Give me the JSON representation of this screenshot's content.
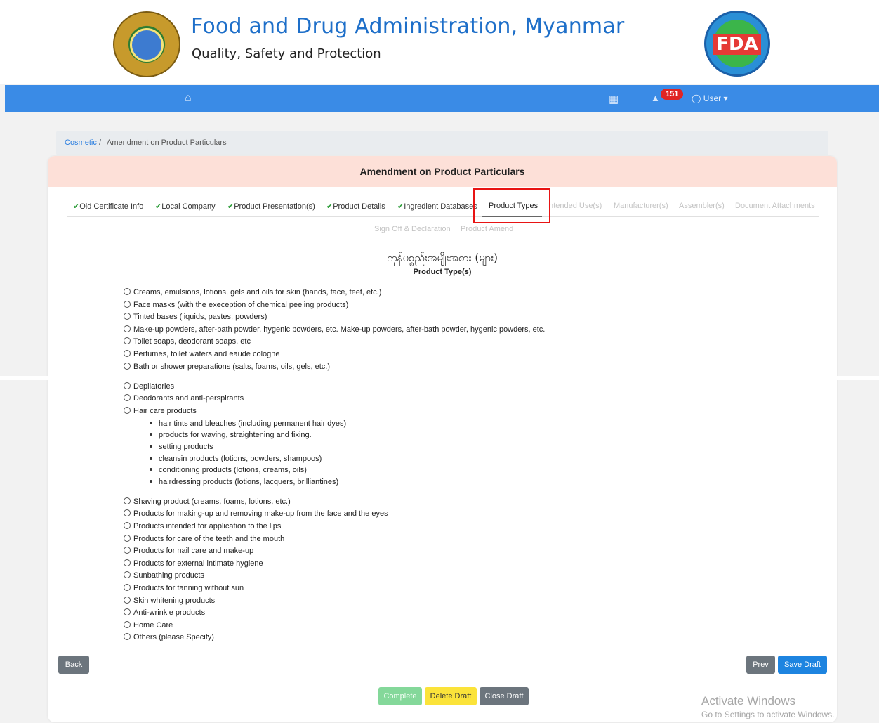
{
  "header": {
    "title": "Food and Drug Administration, Myanmar",
    "subtitle": "Quality, Safety and Protection",
    "left_logo": "ministry-of-health-seal",
    "right_logo_text": "FDA"
  },
  "navbar": {
    "home_icon": "home-icon",
    "map_icon": "map-icon",
    "bell_icon": "bell-icon",
    "notification_count": "151",
    "user_label": "User"
  },
  "breadcrumb": {
    "parent": "Cosmetic",
    "separator": "/",
    "current": "Amendment on Product Particulars"
  },
  "card": {
    "title": "Amendment on Product Particulars"
  },
  "tabs": [
    {
      "label": "Old Certificate Info",
      "state": "done"
    },
    {
      "label": "Local Company",
      "state": "done"
    },
    {
      "label": "Product Presentation(s)",
      "state": "done"
    },
    {
      "label": "Product Details",
      "state": "done"
    },
    {
      "label": "Ingredient Databases",
      "state": "done"
    },
    {
      "label": "Product Types",
      "state": "active"
    },
    {
      "label": "Intended Use(s)",
      "state": "disabled"
    },
    {
      "label": "Manufacturer(s)",
      "state": "disabled"
    },
    {
      "label": "Assembler(s)",
      "state": "disabled"
    },
    {
      "label": "Document Attachments",
      "state": "disabled"
    },
    {
      "label": "Sign Off & Declaration",
      "state": "disabled"
    },
    {
      "label": "Product Amend",
      "state": "disabled"
    }
  ],
  "section": {
    "title_myanmar": "ကုန်ပစ္စည်းအမျိုးအစား (များ)",
    "title_english": "Product Type(s)"
  },
  "options_group1": [
    "Creams, emulsions, lotions, gels and oils for skin (hands, face, feet, etc.)",
    "Face masks (with the exeception of chemical peeling products)",
    "Tinted bases (liquids, pastes, powders)",
    "Make-up powders, after-bath powder, hygenic powders, etc. Make-up powders, after-bath powder, hygenic powders, etc.",
    "Toilet soaps, deodorant soaps, etc",
    "Perfumes, toilet waters and eaude cologne",
    "Bath or shower preparations (salts, foams, oils, gels, etc.)"
  ],
  "options_group2": [
    "Depilatories",
    "Deodorants and anti-perspirants",
    "Hair care products"
  ],
  "hair_care_items": [
    "hair tints and bleaches (including permanent hair dyes)",
    "products for waving, straightening and fixing.",
    "setting products",
    "cleansin products (lotions, powders, shampoos)",
    "conditioning products (lotions, creams, oils)",
    "hairdressing products (lotions, lacquers, brilliantines)"
  ],
  "options_group3": [
    "Shaving product (creams, foams, lotions, etc.)",
    "Products for making-up and removing make-up from the face and the eyes",
    "Products intended for application to the lips",
    "Products for care of the teeth and the mouth",
    "Products for nail care and make-up",
    "Products for external intimate hygiene",
    "Sunbathing products",
    "Products for tanning without sun",
    "Skin whitening products",
    "Anti-wrinkle products",
    "Home Care",
    "Others (please Specify)"
  ],
  "buttons": {
    "back": "Back",
    "prev": "Prev",
    "save_draft": "Save Draft",
    "complete": "Complete",
    "delete_draft": "Delete Draft",
    "close_draft": "Close Draft"
  },
  "watermark": {
    "line1": "Activate Windows",
    "line2": "Go to Settings to activate Windows."
  },
  "colors": {
    "navbar": "#3a8be6",
    "title_blue": "#1e6fc9",
    "card_header": "#fde0d8",
    "check_green": "#2e9d3a",
    "highlight_red": "#e81414"
  }
}
